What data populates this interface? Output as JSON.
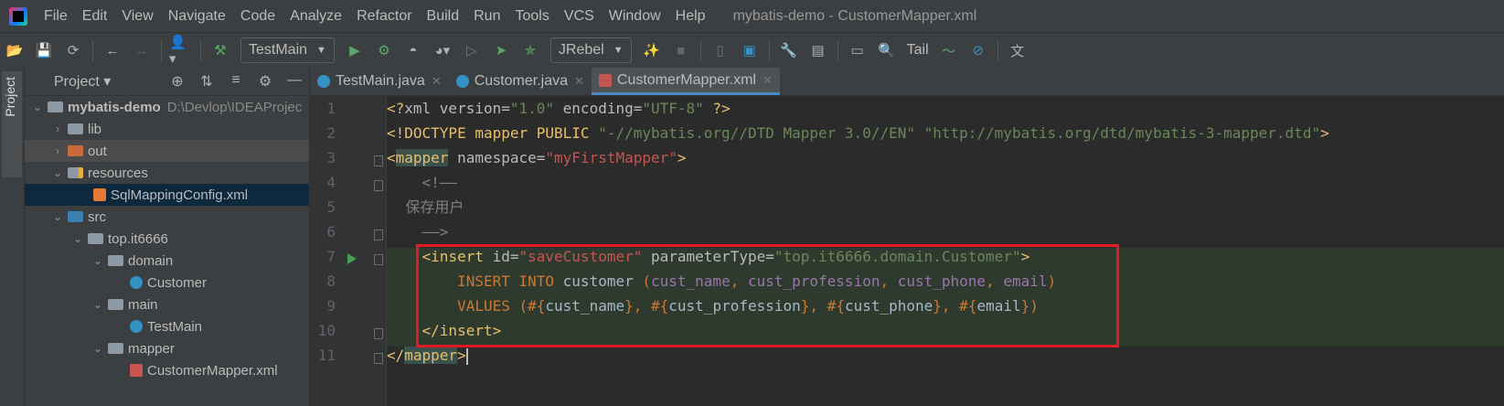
{
  "menubar": {
    "items": [
      "File",
      "Edit",
      "View",
      "Navigate",
      "Code",
      "Analyze",
      "Refactor",
      "Build",
      "Run",
      "Tools",
      "VCS",
      "Window",
      "Help"
    ],
    "window_title": "mybatis-demo - CustomerMapper.xml"
  },
  "toolbar": {
    "run_config": "TestMain",
    "jrebel": "JRebel",
    "tail": "Tail"
  },
  "sidebar_tab": "Project",
  "project_panel": {
    "title": "Project",
    "tree": [
      {
        "label": "mybatis-demo",
        "extra": "D:\\Devlop\\IDEAProjec"
      },
      {
        "label": "lib"
      },
      {
        "label": "out"
      },
      {
        "label": "resources"
      },
      {
        "label": "SqlMappingConfig.xml"
      },
      {
        "label": "src"
      },
      {
        "label": "top.it6666"
      },
      {
        "label": "domain"
      },
      {
        "label": "Customer"
      },
      {
        "label": "main"
      },
      {
        "label": "TestMain"
      },
      {
        "label": "mapper"
      },
      {
        "label": "CustomerMapper.xml"
      }
    ]
  },
  "tabs": [
    {
      "label": "TestMain.java"
    },
    {
      "label": "Customer.java"
    },
    {
      "label": "CustomerMapper.xml"
    }
  ],
  "editor": {
    "line_numbers": [
      "1",
      "2",
      "3",
      "4",
      "5",
      "6",
      "7",
      "8",
      "9",
      "10",
      "11"
    ],
    "code": {
      "l1": {
        "a": "<?",
        "b": "xml version=",
        "c": "\"1.0\"",
        "d": " encoding=",
        "e": "\"UTF-8\"",
        "f": " ?>"
      },
      "l2": {
        "a": "<!DOCTYPE mapper PUBLIC ",
        "b": "\"-//mybatis.org//DTD Mapper 3.0//EN\"",
        "c": " ",
        "d": "\"http://mybatis.org/dtd/mybatis-3-mapper.dtd\"",
        "e": ">"
      },
      "l3": {
        "a": "<",
        "b": "mapper",
        "c": " namespace=",
        "d": "\"myFirstMapper\"",
        "e": ">"
      },
      "l4": "    <!——",
      "l5": "    保存用户",
      "l6": "    ——>",
      "l7": {
        "a": "    <",
        "b": "insert",
        "c": " id=",
        "d": "\"saveCustomer\"",
        "e": " parameterType=",
        "f": "\"top.it6666.domain.Customer\"",
        "g": ">"
      },
      "l8": {
        "a": "        INSERT INTO",
        "b": " customer ",
        "c": "(",
        "d": "cust_name",
        "e": ", ",
        "f": "cust_profession",
        "g": ", ",
        "h": "cust_phone",
        "i": ", ",
        "j": "email",
        "k": ")"
      },
      "l9": {
        "a": "        VALUES ",
        "b": "(#{",
        "c": "cust_name",
        "d": "}, #{",
        "e": "cust_profession",
        "f": "}, #{",
        "g": "cust_phone",
        "h": "}, #{",
        "i": "email",
        "j": "})"
      },
      "l10": {
        "a": "    </",
        "b": "insert",
        "c": ">"
      },
      "l11": {
        "a": "</",
        "b": "mapper",
        "c": ">"
      }
    }
  }
}
